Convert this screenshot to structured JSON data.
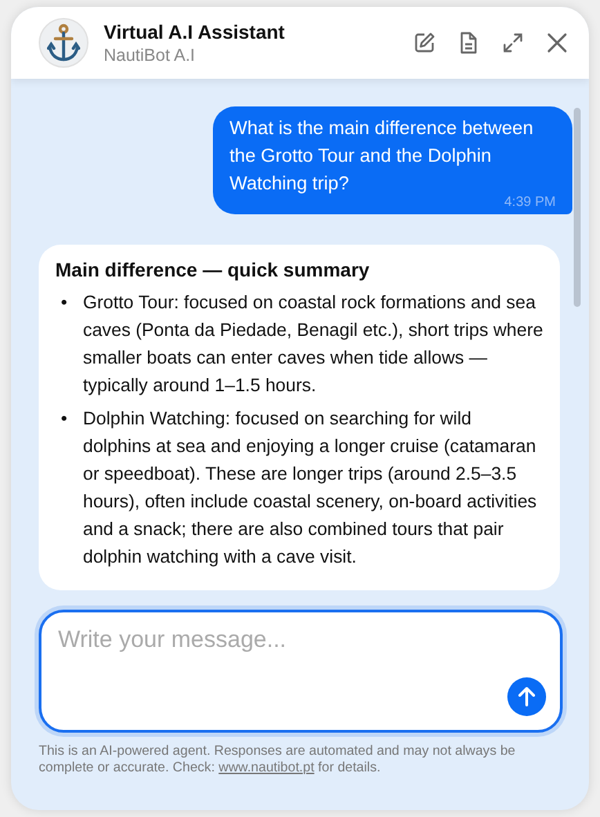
{
  "header": {
    "title": "Virtual A.I Assistant",
    "subtitle": "NautiBot A.I"
  },
  "messages": [
    {
      "kind": "user",
      "text": "What is the main difference between the Grotto Tour and the Dolphin Watching trip?",
      "time": "4:39 PM"
    },
    {
      "kind": "bot",
      "heading": "Main difference — quick summary",
      "bullets": [
        {
          "marker": "•",
          "text": "Grotto Tour: focused on coastal rock formations and sea caves (Ponta da Piedade, Benagil etc.), short trips where smaller boats can enter caves when tide allows — typically around 1–1.5 hours."
        },
        {
          "marker": "•",
          "text": "Dolphin Watching: focused on searching for wild dolphins at sea and enjoying a longer cruise (catamaran or speedboat). These are longer trips (around 2.5–3.5 hours), often include coastal scenery, on-board activities and a snack; there are also combined tours that pair dolphin watching with a cave visit."
        }
      ]
    }
  ],
  "composer": {
    "placeholder": "Write your message..."
  },
  "disclaimer": {
    "text_before": "This is an AI-powered agent. Responses are automated and may not always be complete or accurate. Check: ",
    "link": "www.nautibot.pt",
    "text_after": " for details."
  }
}
